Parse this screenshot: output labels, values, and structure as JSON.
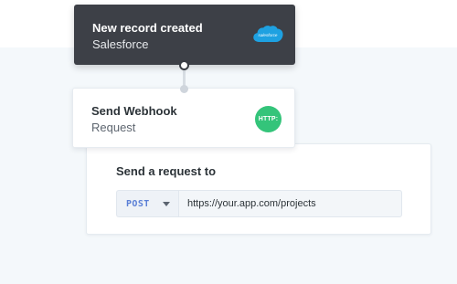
{
  "trigger": {
    "title": "New record created",
    "app": "Salesforce",
    "icon": "salesforce-logo-icon",
    "icon_text": "salesforce",
    "icon_color": "#1ea1e1"
  },
  "action": {
    "title": "Send Webhook",
    "subtitle": "Request",
    "icon": "http-icon",
    "icon_text": "HTTP:",
    "icon_color": "#34c47a"
  },
  "request_panel": {
    "title": "Send a request to",
    "method": "POST",
    "url": "https://your.app.com/projects"
  },
  "colors": {
    "trigger_card_bg": "#3d4047",
    "method_text": "#5a7fd6",
    "page_bg": "#f4f8fb"
  }
}
